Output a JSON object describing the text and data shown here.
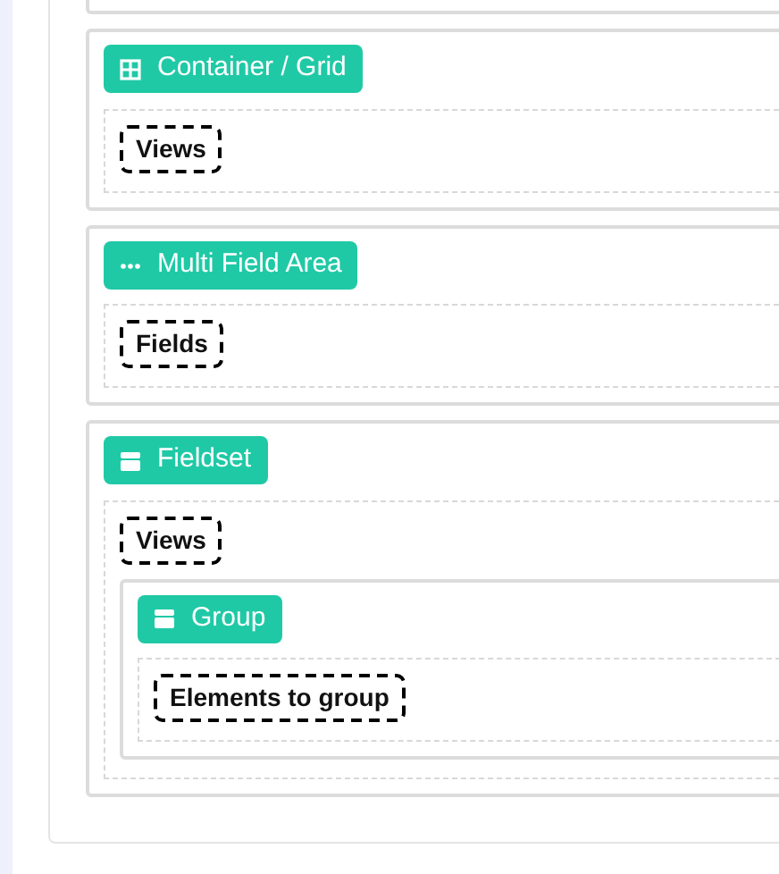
{
  "blocks": [
    {
      "kind": "grid",
      "label": "Container / Grid",
      "slot": "Views"
    },
    {
      "kind": "multi",
      "label": "Multi Field Area",
      "slot": "Fields"
    },
    {
      "kind": "box",
      "label": "Fieldset",
      "slot": "Views",
      "children": [
        {
          "kind": "box",
          "label": "Group",
          "slot": "Elements to group"
        }
      ]
    }
  ]
}
